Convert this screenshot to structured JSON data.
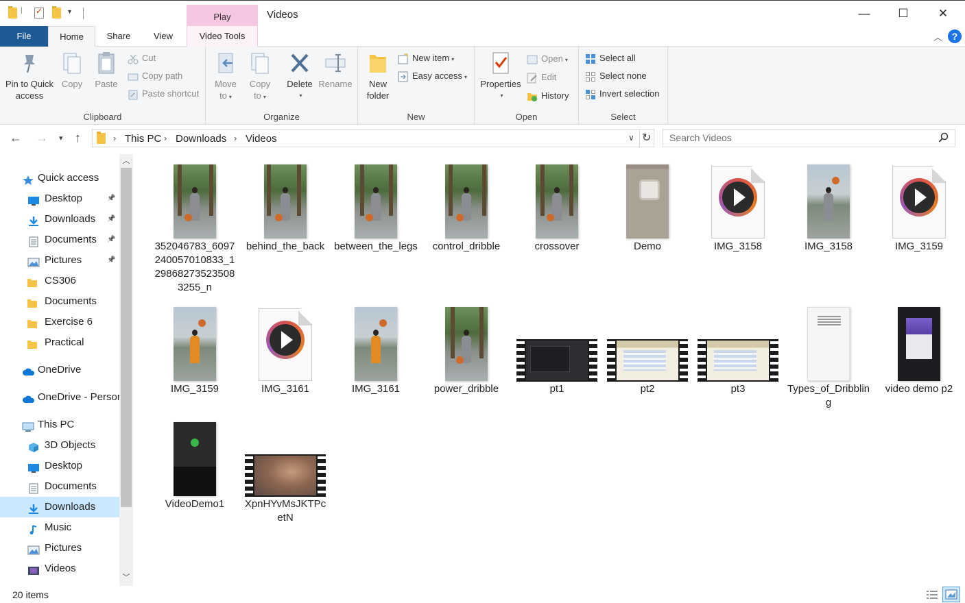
{
  "window": {
    "title": "Videos",
    "context_tab_label": "Play",
    "controls": {
      "minimize": "—",
      "maximize": "☐",
      "close": "✕"
    }
  },
  "tabs": {
    "file": "File",
    "home": "Home",
    "share": "Share",
    "view": "View",
    "video_tools": "Video Tools"
  },
  "ribbon": {
    "clipboard": {
      "label": "Clipboard",
      "pin": [
        "Pin to Quick",
        "access"
      ],
      "copy": "Copy",
      "paste": "Paste",
      "cut": "Cut",
      "copy_path": "Copy path",
      "paste_shortcut": "Paste shortcut"
    },
    "organize": {
      "label": "Organize",
      "move_to": [
        "Move",
        "to"
      ],
      "copy_to": [
        "Copy",
        "to"
      ],
      "delete": "Delete",
      "rename": "Rename"
    },
    "new": {
      "label": "New",
      "new_folder": [
        "New",
        "folder"
      ],
      "new_item": "New item",
      "easy_access": "Easy access"
    },
    "open": {
      "label": "Open",
      "properties": "Properties",
      "open": "Open",
      "edit": "Edit",
      "history": "History"
    },
    "select": {
      "label": "Select",
      "select_all": "Select all",
      "select_none": "Select none",
      "invert_selection": "Invert selection"
    }
  },
  "address": {
    "crumbs": [
      "This PC",
      "Downloads",
      "Videos"
    ],
    "search_placeholder": "Search Videos"
  },
  "nav": [
    {
      "label": "Quick access",
      "icon": "star-icon",
      "level": 0,
      "pinned": false
    },
    {
      "label": "Desktop",
      "icon": "desktop-icon",
      "level": 1,
      "pinned": true
    },
    {
      "label": "Downloads",
      "icon": "download-icon",
      "level": 1,
      "pinned": true
    },
    {
      "label": "Documents",
      "icon": "documents-icon",
      "level": 1,
      "pinned": true
    },
    {
      "label": "Pictures",
      "icon": "pictures-icon",
      "level": 1,
      "pinned": true
    },
    {
      "label": "CS306",
      "icon": "folder-icon",
      "level": 1,
      "pinned": false
    },
    {
      "label": "Documents",
      "icon": "folder-icon",
      "level": 1,
      "pinned": false
    },
    {
      "label": "Exercise 6",
      "icon": "folder-icon",
      "level": 1,
      "pinned": false
    },
    {
      "label": "Practical",
      "icon": "folder-icon",
      "level": 1,
      "pinned": false
    },
    {
      "label": "OneDrive",
      "icon": "cloud-icon",
      "level": 0,
      "pinned": false
    },
    {
      "label": "OneDrive - Person",
      "icon": "cloud-icon",
      "level": 0,
      "pinned": false
    },
    {
      "label": "This PC",
      "icon": "computer-icon",
      "level": 0,
      "pinned": false
    },
    {
      "label": "3D Objects",
      "icon": "cube-icon",
      "level": 1,
      "pinned": false
    },
    {
      "label": "Desktop",
      "icon": "desktop-icon",
      "level": 1,
      "pinned": false
    },
    {
      "label": "Documents",
      "icon": "documents-icon",
      "level": 1,
      "pinned": false
    },
    {
      "label": "Downloads",
      "icon": "download-icon",
      "level": 1,
      "pinned": false,
      "selected": true
    },
    {
      "label": "Music",
      "icon": "music-icon",
      "level": 1,
      "pinned": false
    },
    {
      "label": "Pictures",
      "icon": "pictures-icon",
      "level": 1,
      "pinned": false
    },
    {
      "label": "Videos",
      "icon": "video-icon",
      "level": 1,
      "pinned": false
    }
  ],
  "files": [
    {
      "name": "352046783_6097240057010833_129868273523508 3255_n",
      "thumb": "photo"
    },
    {
      "name": "behind_the_back",
      "thumb": "photo"
    },
    {
      "name": "between_the_legs",
      "thumb": "photo"
    },
    {
      "name": "control_dribble",
      "thumb": "photo"
    },
    {
      "name": "crossover",
      "thumb": "photo"
    },
    {
      "name": "Demo",
      "thumb": "app"
    },
    {
      "name": "IMG_3158",
      "thumb": "media"
    },
    {
      "name": "IMG_3158",
      "thumb": "city"
    },
    {
      "name": "IMG_3159",
      "thumb": "media"
    },
    {
      "name": "IMG_3159",
      "thumb": "orange"
    },
    {
      "name": "IMG_3161",
      "thumb": "media"
    },
    {
      "name": "IMG_3161",
      "thumb": "orange"
    },
    {
      "name": "power_dribble",
      "thumb": "photo"
    },
    {
      "name": "pt1",
      "thumb": "film-dark"
    },
    {
      "name": "pt2",
      "thumb": "film-sheet"
    },
    {
      "name": "pt3",
      "thumb": "film-sheet"
    },
    {
      "name": "Types_of_Dribbling",
      "thumb": "paper"
    },
    {
      "name": "video demo p2",
      "thumb": "screen"
    },
    {
      "name": "VideoDemo1",
      "thumb": "tablet"
    },
    {
      "name": "XpnHYvMsJKTPcetN",
      "thumb": "film-blur"
    }
  ],
  "status": {
    "item_count": "20 items"
  },
  "colors": {
    "file_tab": "#1d5a96",
    "selection": "#cce8ff",
    "play_tab": "#f7c6e2",
    "help": "#1a73e8"
  }
}
